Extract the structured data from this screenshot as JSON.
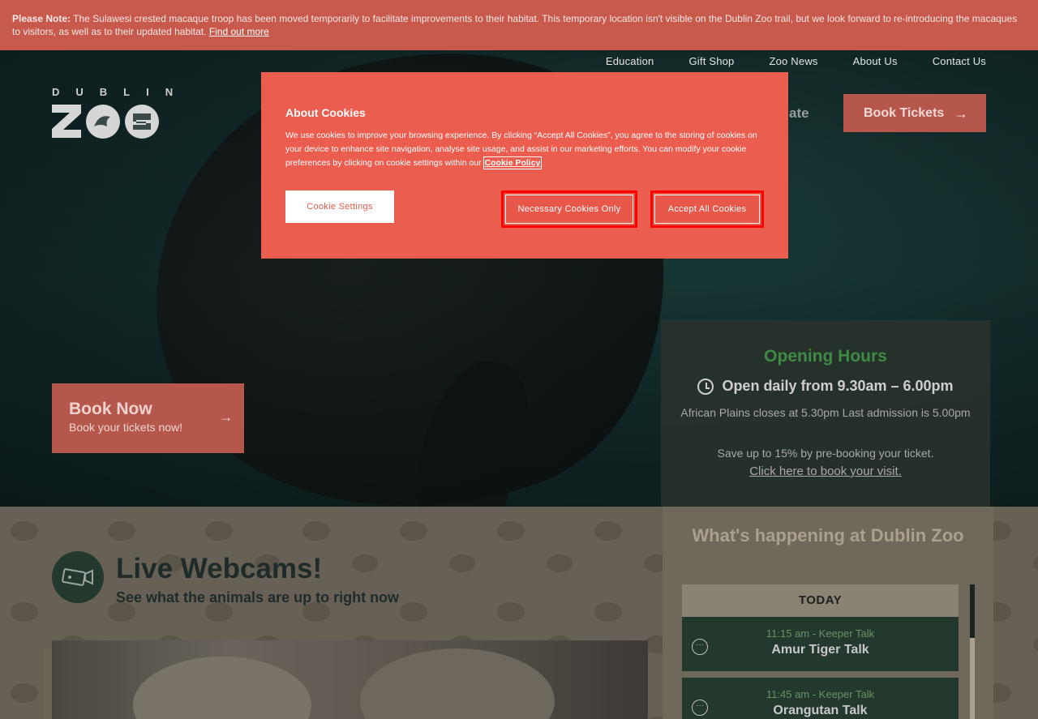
{
  "notice": {
    "label": "Please Note:",
    "text": "The Sulawesi crested macaque troop has been moved temporarily to facilitate improvements to their habitat. This temporary location isn't visible on the Dublin Zoo trail, but we look forward to re-introducing the macaques to visitors, as well as to their updated habitat.",
    "link": "Find out more"
  },
  "topnav": [
    "Education",
    "Gift Shop",
    "Zoo News",
    "About Us",
    "Contact Us"
  ],
  "logo": {
    "word": "DUBLIN",
    "mark": "ZOO"
  },
  "header": {
    "donate": "Donate",
    "book_tickets": "Book Tickets"
  },
  "booknow": {
    "title": "Book Now",
    "subtitle": "Book your tickets now!"
  },
  "hours": {
    "title": "Opening Hours",
    "open": "Open daily from 9.30am – 6.00pm",
    "close_note": "African Plains closes at 5.30pm Last admission is 5.00pm",
    "save_note": "Save up to 15% by pre-booking your ticket.",
    "link": "Click here to book your visit."
  },
  "webcams": {
    "title": "Live Webcams!",
    "subtitle": "See what the animals are up to right now"
  },
  "happening": {
    "title": "What's happening at Dublin Zoo",
    "day_label": "TODAY",
    "events": [
      {
        "time": "11:15 am - Keeper Talk",
        "name": "Amur Tiger Talk"
      },
      {
        "time": "11:45 am - Keeper Talk",
        "name": "Orangutan Talk"
      }
    ]
  },
  "cookie": {
    "title": "About Cookies",
    "body": "We use cookies to improve your browsing experience. By clicking “Accept All Cookies”, you agree to the storing of cookies on your device to enhance site navigation, analyse site usage, and assist in our marketing efforts. You can modify your cookie preferences by clicking on cookie settings within our",
    "policy_link": "Cookie Policy",
    "settings_btn": "Cookie Settings",
    "necessary_btn": "Necessary Cookies Only",
    "accept_btn": "Accept All Cookies"
  },
  "colors": {
    "accent": "#eb5d4e",
    "green": "#3f8a44",
    "dark": "#23392e"
  }
}
